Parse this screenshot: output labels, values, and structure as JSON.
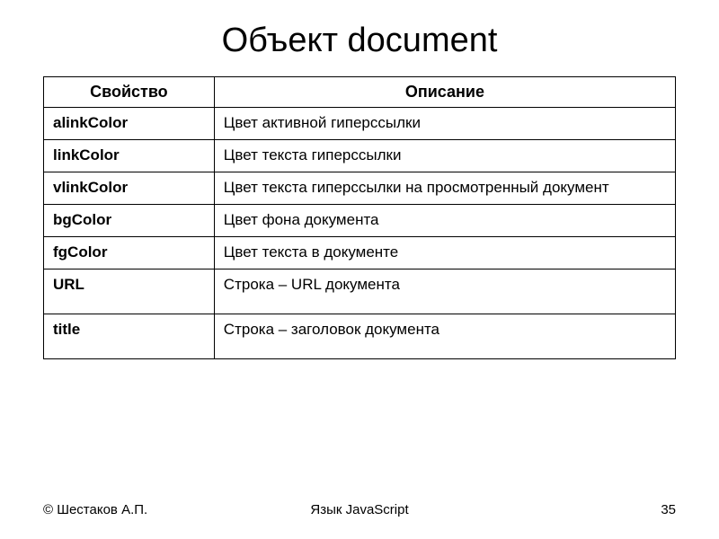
{
  "slide": {
    "title": "Объект document"
  },
  "table": {
    "headers": {
      "property": "Свойство",
      "description": "Описание"
    },
    "rows": [
      {
        "property": "alinkColor",
        "description": "Цвет активной гиперссылки"
      },
      {
        "property": "linkColor",
        "description": "Цвет текста гиперссылки"
      },
      {
        "property": "vlinkColor",
        "description": "Цвет текста гиперссылки на просмотренный документ"
      },
      {
        "property": "bgColor",
        "description": "Цвет фона документа"
      },
      {
        "property": "fgColor",
        "description": "Цвет текста в документе"
      },
      {
        "property": "URL",
        "description": "Строка – URL документа"
      },
      {
        "property": "title",
        "description": "Строка – заголовок документа"
      }
    ]
  },
  "footer": {
    "author": "© Шестаков А.П.",
    "subject": "Язык JavaScript",
    "page_number": "35"
  }
}
